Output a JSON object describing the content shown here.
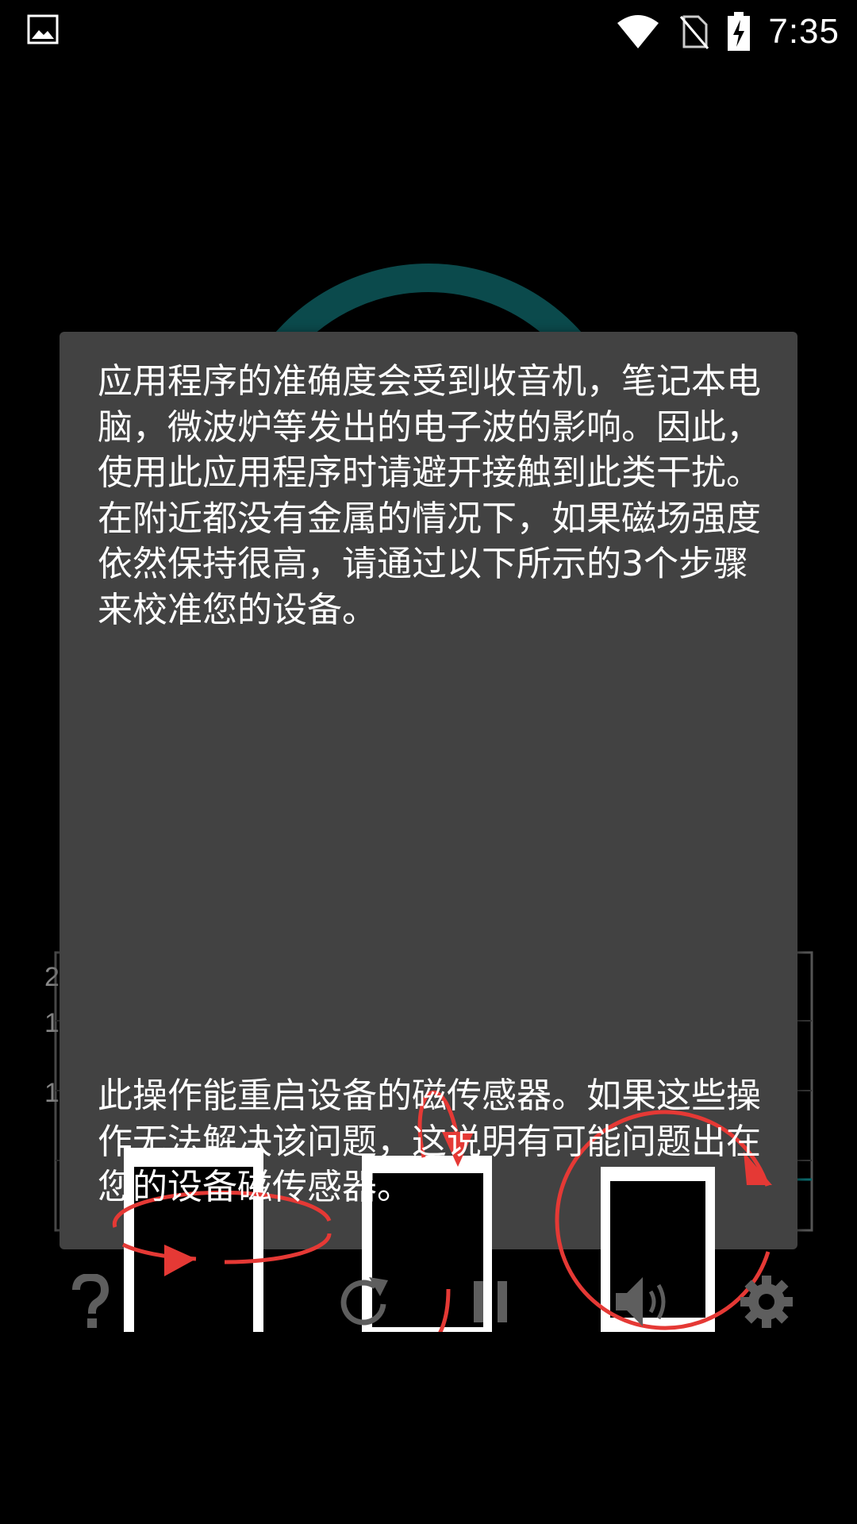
{
  "status_bar": {
    "time": "7:35",
    "icons": [
      "gallery-icon",
      "wifi-icon",
      "no-sim-icon",
      "battery-charging-icon"
    ]
  },
  "background": {
    "gauge_color": "#0b4a4c",
    "axis_labels": [
      "2",
      "1",
      "1"
    ]
  },
  "dialog": {
    "paragraph_top": "应用程序的准确度会受到收音机，笔记本电脑，微波炉等发出的电子波的影响。因此，使用此应用程序时请避开接触到此类干扰。在附近都没有金属的情况下，如果磁场强度依然保持很高，请通过以下所示的3个步骤来校准您的设备。",
    "paragraph_bottom": "此操作能重启设备的磁传感器。如果这些操作无法解决该问题，这说明有可能问题出在您的设备磁传感器。",
    "accent_color": "#e53935",
    "steps": [
      "rotate-horizontal-icon",
      "rotate-vertical-icon",
      "rotate-circular-icon"
    ]
  },
  "toolbar": {
    "items": [
      "help-icon",
      "refresh-icon",
      "pause-icon",
      "volume-icon",
      "settings-icon"
    ],
    "icon_color": "#5e5e5e"
  }
}
